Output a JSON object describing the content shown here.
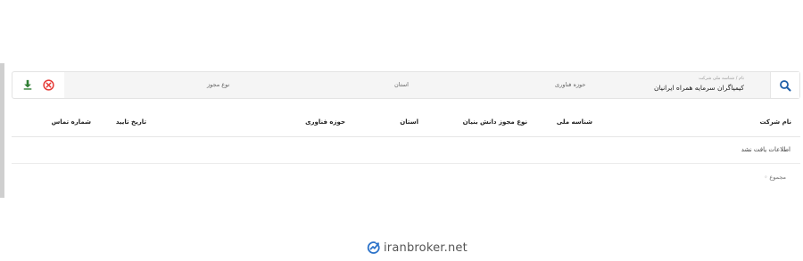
{
  "filters": {
    "company_label": "نام / شناسه ملی شرکت",
    "company_value": "کیمیاگران سرمایه همراه ایرانیان",
    "tech_field_placeholder": "حوزه فناوری",
    "province_placeholder": "استان",
    "license_type_placeholder": "نوع مجوز"
  },
  "icons": {
    "search": "search-icon",
    "clear": "close-circle-icon",
    "download": "download-icon"
  },
  "colors": {
    "accent_blue": "#1f5fa8",
    "clear_red": "#e53935",
    "download_green": "#2e7d32"
  },
  "table": {
    "headers": [
      "نام شرکت",
      "شناسه ملی",
      "نوع مجوز دانش بنیان",
      "استان",
      "حوزه فناوری",
      "تاریخ تایید",
      "شماره تماس"
    ],
    "empty_message": "اطلاعات یافت نشد",
    "total_label": "مجموع"
  },
  "watermark": {
    "text": "iranbroker.net"
  }
}
